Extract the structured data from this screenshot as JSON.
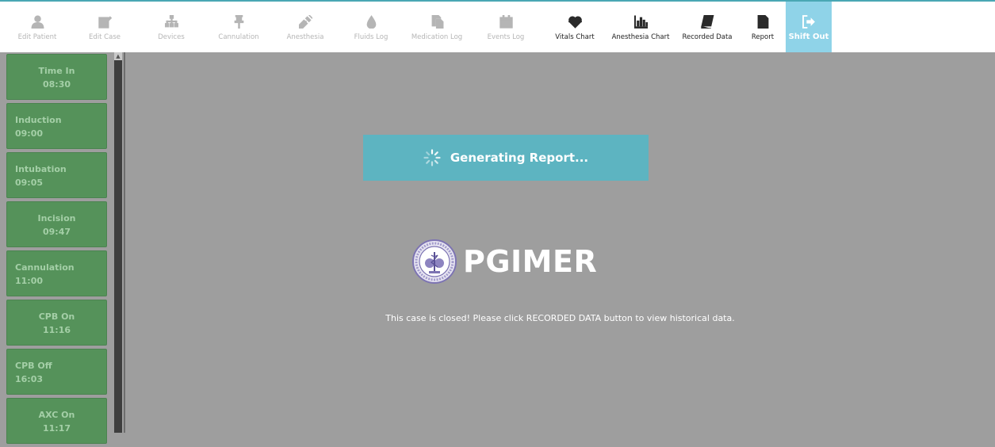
{
  "toolbar": {
    "items": [
      {
        "label": "Edit Patient",
        "icon": "user-icon",
        "state": "disabled"
      },
      {
        "label": "Edit Case",
        "icon": "edit-icon",
        "state": "disabled"
      },
      {
        "label": "Devices",
        "icon": "sitemap-icon",
        "state": "disabled"
      },
      {
        "label": "Cannulation",
        "icon": "pin-icon",
        "state": "disabled"
      },
      {
        "label": "Anesthesia",
        "icon": "syringe-icon",
        "state": "disabled"
      },
      {
        "label": "Fluids Log",
        "icon": "drop-icon",
        "state": "disabled"
      },
      {
        "label": "Medication Log",
        "icon": "copy-icon",
        "state": "disabled"
      },
      {
        "label": "Events Log",
        "icon": "calendar-icon",
        "state": "disabled"
      },
      {
        "label": "Vitals Chart",
        "icon": "heartbeat-icon",
        "state": "active"
      },
      {
        "label": "Anesthesia Chart",
        "icon": "bar-chart-icon",
        "state": "active"
      },
      {
        "label": "Recorded Data",
        "icon": "book-icon",
        "state": "active"
      },
      {
        "label": "Report",
        "icon": "file-icon",
        "state": "active"
      },
      {
        "label": "Shift Out",
        "icon": "sign-out-icon",
        "state": "highlight"
      }
    ]
  },
  "events": [
    {
      "name": "Time In",
      "time": "08:30",
      "align": "center"
    },
    {
      "name": "Induction",
      "time": "09:00",
      "align": "left"
    },
    {
      "name": "Intubation",
      "time": "09:05",
      "align": "left"
    },
    {
      "name": "Incision",
      "time": "09:47",
      "align": "center"
    },
    {
      "name": "Cannulation",
      "time": "11:00",
      "align": "left"
    },
    {
      "name": "CPB On",
      "time": "11:16",
      "align": "center"
    },
    {
      "name": "CPB Off",
      "time": "16:03",
      "align": "left"
    },
    {
      "name": "AXC On",
      "time": "11:17",
      "align": "center"
    }
  ],
  "banner": {
    "text": "Generating Report...",
    "icon": "spinner-icon"
  },
  "logo": {
    "text": "PGIMER",
    "icon": "seal-icon"
  },
  "message": "This case is closed! Please click RECORDED DATA button to view historical data.",
  "colors": {
    "accent": "#5db4c1",
    "event_green": "#55925a",
    "shift_out": "#8fd3e8",
    "background": "#9e9e9e"
  }
}
